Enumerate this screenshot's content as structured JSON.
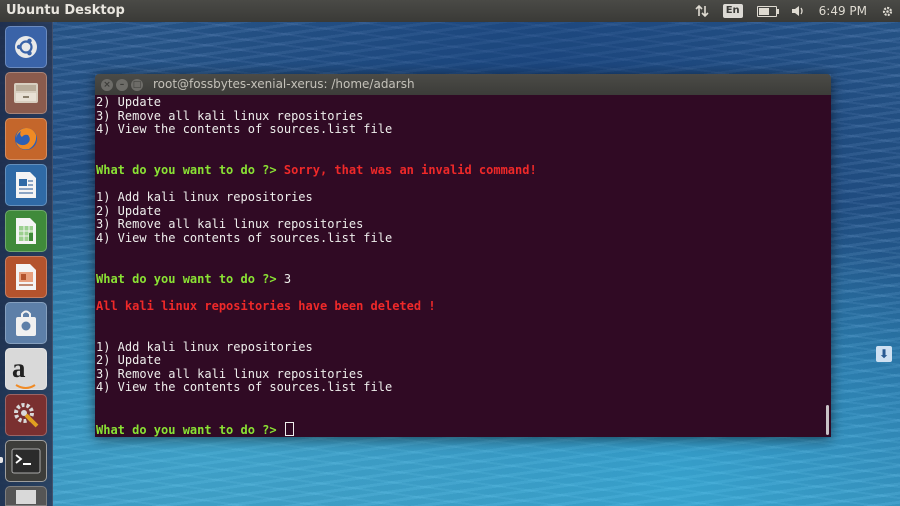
{
  "topbar": {
    "title": "Ubuntu Desktop",
    "keyboard_layout": "En",
    "time": "6:49 PM",
    "battery_level": 0.6
  },
  "launcher": {
    "items": [
      {
        "name": "dash-home",
        "icon": "ubuntu-logo-icon"
      },
      {
        "name": "files",
        "icon": "file-cabinet-icon"
      },
      {
        "name": "firefox",
        "icon": "firefox-icon"
      },
      {
        "name": "libreoffice-writer",
        "icon": "writer-document-icon"
      },
      {
        "name": "libreoffice-calc",
        "icon": "calc-spreadsheet-icon"
      },
      {
        "name": "libreoffice-impress",
        "icon": "impress-presentation-icon"
      },
      {
        "name": "software-center",
        "icon": "shopping-bag-icon"
      },
      {
        "name": "amazon",
        "icon": "amazon-icon"
      },
      {
        "name": "system-settings",
        "icon": "settings-wrench-icon"
      },
      {
        "name": "terminal",
        "icon": "terminal-icon",
        "running": true
      },
      {
        "name": "workspace-switcher",
        "icon": "workspace-icon"
      }
    ]
  },
  "terminal": {
    "window_title": "root@fossbytes-xenial-xerus: /home/adarsh",
    "lines": [
      {
        "parts": [
          {
            "text": "2) Update",
            "style": "normal"
          }
        ]
      },
      {
        "parts": [
          {
            "text": "3) Remove all kali linux repositories",
            "style": "normal"
          }
        ]
      },
      {
        "parts": [
          {
            "text": "4) View the contents of sources.list file",
            "style": "normal"
          }
        ]
      },
      {
        "parts": []
      },
      {
        "parts": []
      },
      {
        "parts": [
          {
            "text": "What do you want to do ?> ",
            "style": "prompt"
          },
          {
            "text": "Sorry, that was an invalid command!",
            "style": "err"
          }
        ]
      },
      {
        "parts": []
      },
      {
        "parts": [
          {
            "text": "1) Add kali linux repositories",
            "style": "normal"
          }
        ]
      },
      {
        "parts": [
          {
            "text": "2) Update",
            "style": "normal"
          }
        ]
      },
      {
        "parts": [
          {
            "text": "3) Remove all kali linux repositories",
            "style": "normal"
          }
        ]
      },
      {
        "parts": [
          {
            "text": "4) View the contents of sources.list file",
            "style": "normal"
          }
        ]
      },
      {
        "parts": []
      },
      {
        "parts": []
      },
      {
        "parts": [
          {
            "text": "What do you want to do ?> ",
            "style": "prompt"
          },
          {
            "text": "3",
            "style": "normal"
          }
        ]
      },
      {
        "parts": []
      },
      {
        "parts": [
          {
            "text": "All kali linux repositories have been deleted !",
            "style": "err"
          }
        ]
      },
      {
        "parts": []
      },
      {
        "parts": []
      },
      {
        "parts": [
          {
            "text": "1) Add kali linux repositories",
            "style": "normal"
          }
        ]
      },
      {
        "parts": [
          {
            "text": "2) Update",
            "style": "normal"
          }
        ]
      },
      {
        "parts": [
          {
            "text": "3) Remove all kali linux repositories",
            "style": "normal"
          }
        ]
      },
      {
        "parts": [
          {
            "text": "4) View the contents of sources.list file",
            "style": "normal"
          }
        ]
      },
      {
        "parts": []
      },
      {
        "parts": []
      },
      {
        "parts": [
          {
            "text": "What do you want to do ?> ",
            "style": "prompt"
          }
        ],
        "cursor": true
      }
    ]
  },
  "colors": {
    "terminal_bg": "#300a24",
    "prompt_green": "#8ae234",
    "error_red": "#ef2929",
    "text": "#eeeeec"
  }
}
